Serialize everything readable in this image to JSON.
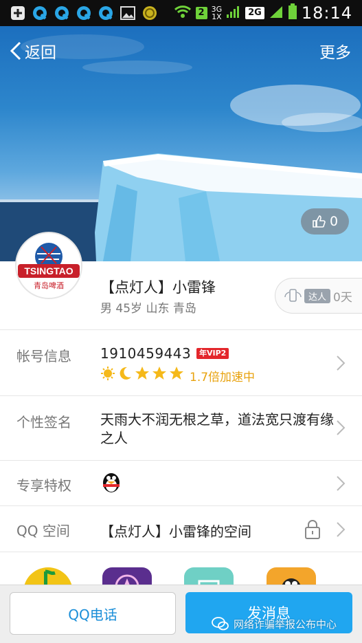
{
  "status_bar": {
    "time": "18:14",
    "notification_count": "2",
    "network_3g": "3G",
    "network_1x": "1X",
    "network_2g": "2G",
    "icons": [
      "add-icon",
      "qq-icon",
      "qq-icon",
      "qq-icon",
      "qq-icon",
      "image-icon",
      "coin-icon",
      "wifi-icon",
      "sim-icon",
      "signal-icon",
      "battery-icon"
    ]
  },
  "header": {
    "back_label": "返回",
    "more_label": "更多"
  },
  "cover": {
    "like_count": "0"
  },
  "profile": {
    "avatar_brand": "TSINGTAO",
    "avatar_subtext": "青岛啤酒",
    "name": "【点灯人】小雷锋",
    "meta": "男 45岁 山东 青岛",
    "daren_label": "达人",
    "daren_days": "0天"
  },
  "account": {
    "label": "帐号信息",
    "qq_number": "1910459443",
    "vip_badge": "年VIP2",
    "speed_text": "1.7倍加速中"
  },
  "signature": {
    "label": "个性签名",
    "text": "天雨大不润无根之草，道法宽只渡有缘之人"
  },
  "privileges": {
    "label": "专享特权"
  },
  "qzone": {
    "label": "QQ 空间",
    "value": "【点灯人】小雷锋的空间"
  },
  "actions": {
    "phone_label": "QQ电话",
    "message_label": "发消息"
  },
  "watermark": {
    "text": "网络诈骗举报公布中心"
  },
  "colors": {
    "accent": "#20a6f0",
    "vip_red": "#e3262b",
    "speed_orange": "#e8a20d"
  }
}
